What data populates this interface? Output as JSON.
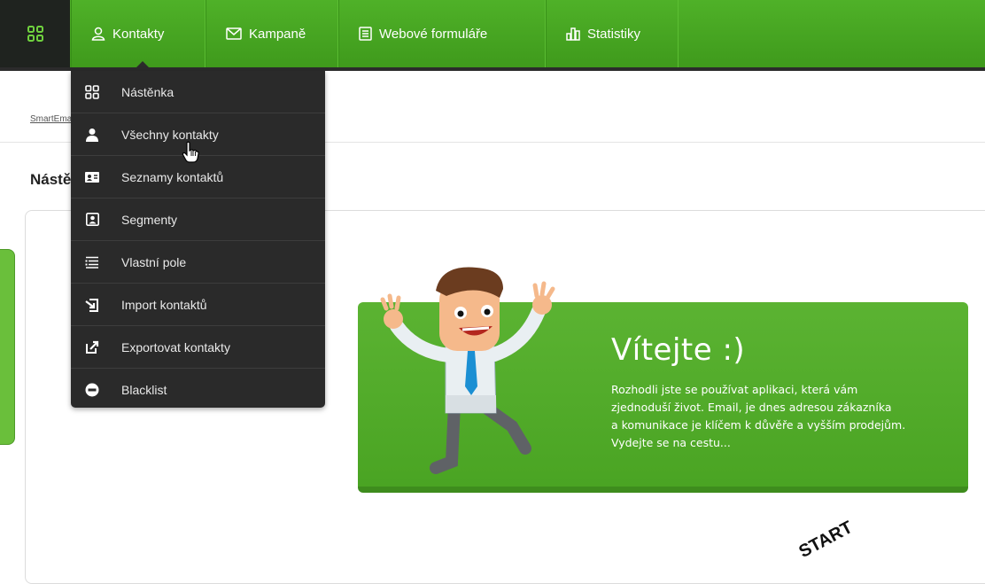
{
  "colors": {
    "accent_green": "#4fb128",
    "dark_menu": "#2a2a2a",
    "home_bg": "#1f231f"
  },
  "nav": {
    "home_icon": "grid-icon",
    "items": [
      {
        "label": "Kontakty",
        "icon": "user-icon"
      },
      {
        "label": "Kampaně",
        "icon": "mail-icon"
      },
      {
        "label": "Webové formuláře",
        "icon": "form-icon"
      },
      {
        "label": "Statistiky",
        "icon": "bar-chart-icon"
      }
    ]
  },
  "breadcrumb": "SmartEma",
  "page": {
    "title": "Nástě"
  },
  "dropdown": {
    "items": [
      {
        "label": "Nástěnka",
        "icon": "grid-icon"
      },
      {
        "label": "Všechny kontakty",
        "icon": "person-icon"
      },
      {
        "label": "Seznamy kontaktů",
        "icon": "contact-card-icon"
      },
      {
        "label": "Segmenty",
        "icon": "portrait-icon"
      },
      {
        "label": "Vlastní pole",
        "icon": "list-icon"
      },
      {
        "label": "Import kontaktů",
        "icon": "import-icon"
      },
      {
        "label": "Exportovat kontakty",
        "icon": "export-icon"
      },
      {
        "label": "Blacklist",
        "icon": "minus-circle-icon"
      }
    ]
  },
  "banner": {
    "title": "Vítejte :)",
    "lines": [
      "Rozhodli jste se používat aplikaci, která vám",
      "zjednoduší život. Email, je dnes adresou zákazníka",
      "a komunikace je klíčem k důvěře a vyšším prodejům.",
      "Vydejte se na cestu..."
    ]
  },
  "start_label": "START"
}
